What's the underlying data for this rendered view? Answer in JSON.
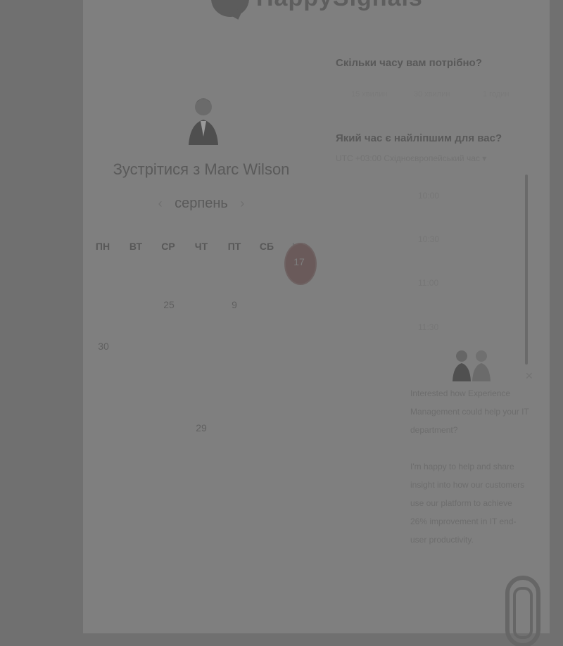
{
  "logo": {
    "text": "HappySignals"
  },
  "host": {
    "title": "Зустрітися з Marc Wilson"
  },
  "calendar": {
    "month": "серпень",
    "prev_icon": "chevron-left-icon",
    "next_icon": "chevron-right-icon",
    "weekdays": [
      "ПН",
      "ВТ",
      "СР",
      "ЧТ",
      "ПТ",
      "СБ",
      "НД"
    ],
    "today": "17",
    "visible_days": {
      "d25": "25",
      "d9": "9",
      "d30": "30",
      "d29": "29"
    }
  },
  "duration": {
    "question": "Скільки часу вам потрібно?",
    "options": [
      "15 хвилин",
      "30 хвилин",
      "1 годин"
    ]
  },
  "time": {
    "question": "Який час є найліпшим для вас?",
    "timezone": "UTC +03:00 Східноєвропейський час ▾",
    "slots": [
      "10:00",
      "10:30",
      "11:00",
      "11:30"
    ]
  },
  "chat": {
    "close": "✕",
    "message1": "Interested how Experience Management could help your IT department?",
    "message2": "I'm happy to help and share insight into how our customers use our platform to achieve 26% improvement in IT end-user productivity."
  }
}
